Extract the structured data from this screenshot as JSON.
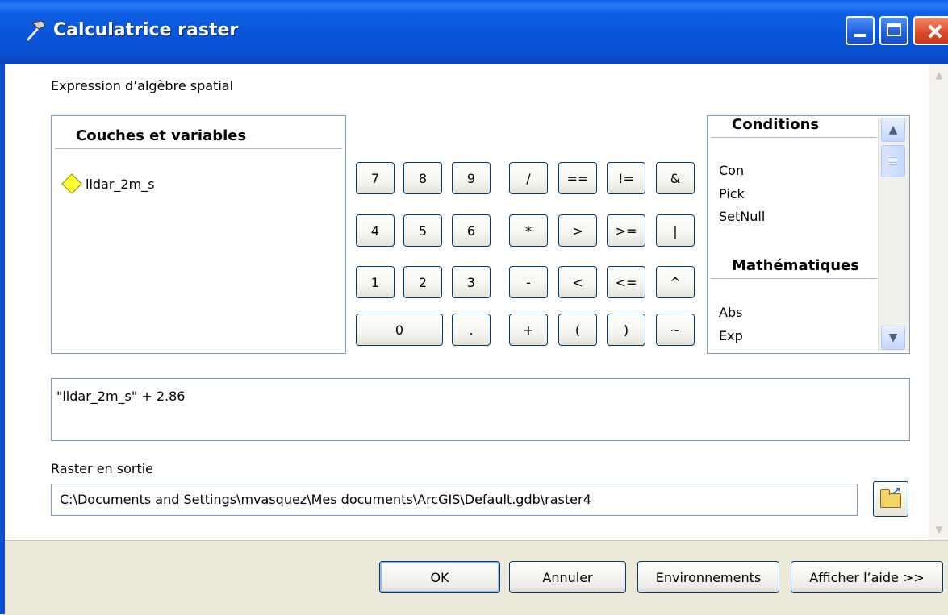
{
  "window": {
    "title": "Calculatrice raster"
  },
  "expression_label": "Expression d’algèbre spatial",
  "layers": {
    "header": "Couches et variables",
    "items": [
      "lidar_2m_s"
    ]
  },
  "keypad": {
    "row1": [
      "7",
      "8",
      "9",
      "/",
      "==",
      "!=",
      "&"
    ],
    "row2": [
      "4",
      "5",
      "6",
      "*",
      ">",
      ">=",
      "|"
    ],
    "row3": [
      "1",
      "2",
      "3",
      "-",
      "<",
      "<=",
      "^"
    ],
    "row4": [
      "0",
      ".",
      "+",
      "(",
      ")",
      "~"
    ]
  },
  "functions": {
    "groups": [
      {
        "title": "Conditions",
        "items": [
          "Con",
          "Pick",
          "SetNull"
        ]
      },
      {
        "title": "Mathématiques",
        "items": [
          "Abs",
          "Exp"
        ]
      }
    ]
  },
  "expression": {
    "value": "\"lidar_2m_s\" + 2.86"
  },
  "output": {
    "label": "Raster en sortie",
    "value": "C:\\Documents and Settings\\mvasquez\\Mes documents\\ArcGIS\\Default.gdb\\raster4"
  },
  "buttons": {
    "ok": "OK",
    "cancel": "Annuler",
    "environments": "Environnements",
    "help": "Afficher l’aide >>"
  }
}
